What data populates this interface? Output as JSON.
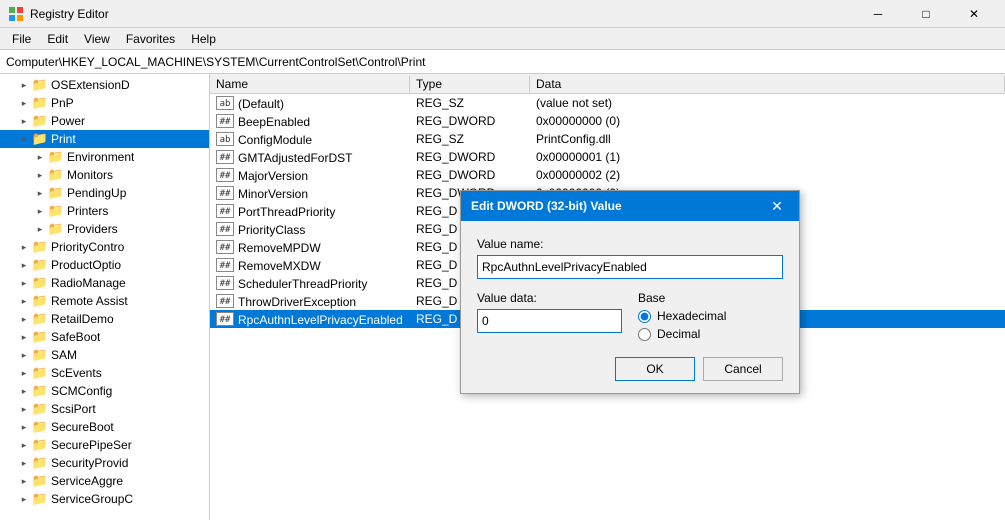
{
  "titleBar": {
    "title": "Registry Editor",
    "icon": "🗂",
    "minimizeLabel": "─",
    "maximizeLabel": "□",
    "closeLabel": "✕"
  },
  "menuBar": {
    "items": [
      "File",
      "Edit",
      "View",
      "Favorites",
      "Help"
    ]
  },
  "addressBar": {
    "path": "Computer\\HKEY_LOCAL_MACHINE\\SYSTEM\\CurrentControlSet\\Control\\Print"
  },
  "tree": {
    "items": [
      {
        "label": "OSExtensionD",
        "indent": 1,
        "expanded": false,
        "selected": false
      },
      {
        "label": "PnP",
        "indent": 1,
        "expanded": false,
        "selected": false
      },
      {
        "label": "Power",
        "indent": 1,
        "expanded": false,
        "selected": false
      },
      {
        "label": "Print",
        "indent": 1,
        "expanded": true,
        "selected": true
      },
      {
        "label": "Environment",
        "indent": 2,
        "expanded": false,
        "selected": false
      },
      {
        "label": "Monitors",
        "indent": 2,
        "expanded": false,
        "selected": false
      },
      {
        "label": "PendingUp",
        "indent": 2,
        "expanded": false,
        "selected": false
      },
      {
        "label": "Printers",
        "indent": 2,
        "expanded": false,
        "selected": false
      },
      {
        "label": "Providers",
        "indent": 2,
        "expanded": false,
        "selected": false
      },
      {
        "label": "PriorityContro",
        "indent": 1,
        "expanded": false,
        "selected": false
      },
      {
        "label": "ProductOptio",
        "indent": 1,
        "expanded": false,
        "selected": false
      },
      {
        "label": "RadioManage",
        "indent": 1,
        "expanded": false,
        "selected": false
      },
      {
        "label": "Remote Assist",
        "indent": 1,
        "expanded": false,
        "selected": false
      },
      {
        "label": "RetailDemo",
        "indent": 1,
        "expanded": false,
        "selected": false
      },
      {
        "label": "SafeBoot",
        "indent": 1,
        "expanded": false,
        "selected": false
      },
      {
        "label": "SAM",
        "indent": 1,
        "expanded": false,
        "selected": false
      },
      {
        "label": "ScEvents",
        "indent": 1,
        "expanded": false,
        "selected": false
      },
      {
        "label": "SCMConfig",
        "indent": 1,
        "expanded": false,
        "selected": false
      },
      {
        "label": "ScsiPort",
        "indent": 1,
        "expanded": false,
        "selected": false
      },
      {
        "label": "SecureBoot",
        "indent": 1,
        "expanded": false,
        "selected": false
      },
      {
        "label": "SecurePipeSer",
        "indent": 1,
        "expanded": false,
        "selected": false
      },
      {
        "label": "SecurityProvid",
        "indent": 1,
        "expanded": false,
        "selected": false
      },
      {
        "label": "ServiceAggre",
        "indent": 1,
        "expanded": false,
        "selected": false
      },
      {
        "label": "ServiceGroupC",
        "indent": 1,
        "expanded": false,
        "selected": false
      }
    ]
  },
  "columns": {
    "name": "Name",
    "type": "Type",
    "data": "Data"
  },
  "values": [
    {
      "name": "(Default)",
      "type": "REG_SZ",
      "data": "(value not set)",
      "iconType": "ab"
    },
    {
      "name": "BeepEnabled",
      "type": "REG_DWORD",
      "data": "0x00000000 (0)",
      "iconType": "dword"
    },
    {
      "name": "ConfigModule",
      "type": "REG_SZ",
      "data": "PrintConfig.dll",
      "iconType": "ab"
    },
    {
      "name": "GMTAdjustedForDST",
      "type": "REG_DWORD",
      "data": "0x00000001 (1)",
      "iconType": "dword"
    },
    {
      "name": "MajorVersion",
      "type": "REG_DWORD",
      "data": "0x00000002 (2)",
      "iconType": "dword"
    },
    {
      "name": "MinorVersion",
      "type": "REG_DWORD",
      "data": "0x00000000 (0)",
      "iconType": "dword"
    },
    {
      "name": "PortThreadPriority",
      "type": "REG_D",
      "data": "",
      "iconType": "dword"
    },
    {
      "name": "PriorityClass",
      "type": "REG_D",
      "data": "",
      "iconType": "dword"
    },
    {
      "name": "RemoveMPDW",
      "type": "REG_D",
      "data": "",
      "iconType": "dword"
    },
    {
      "name": "RemoveMXDW",
      "type": "REG_D",
      "data": "",
      "iconType": "dword"
    },
    {
      "name": "SchedulerThreadPriority",
      "type": "REG_D",
      "data": "",
      "iconType": "dword"
    },
    {
      "name": "ThrowDriverException",
      "type": "REG_D",
      "data": "",
      "iconType": "dword"
    },
    {
      "name": "RpcAuthnLevelPrivacyEnabled",
      "type": "REG_D",
      "data": "",
      "iconType": "dword",
      "selected": true
    }
  ],
  "dialog": {
    "title": "Edit DWORD (32-bit) Value",
    "valueNameLabel": "Value name:",
    "valueNameValue": "RpcAuthnLevelPrivacyEnabled",
    "valueDataLabel": "Value data:",
    "valueDataValue": "0",
    "baseLabel": "Base",
    "baseOptions": [
      {
        "label": "Hexadecimal",
        "value": "hex",
        "checked": true
      },
      {
        "label": "Decimal",
        "value": "dec",
        "checked": false
      }
    ],
    "okLabel": "OK",
    "cancelLabel": "Cancel",
    "closeLabel": "✕"
  }
}
